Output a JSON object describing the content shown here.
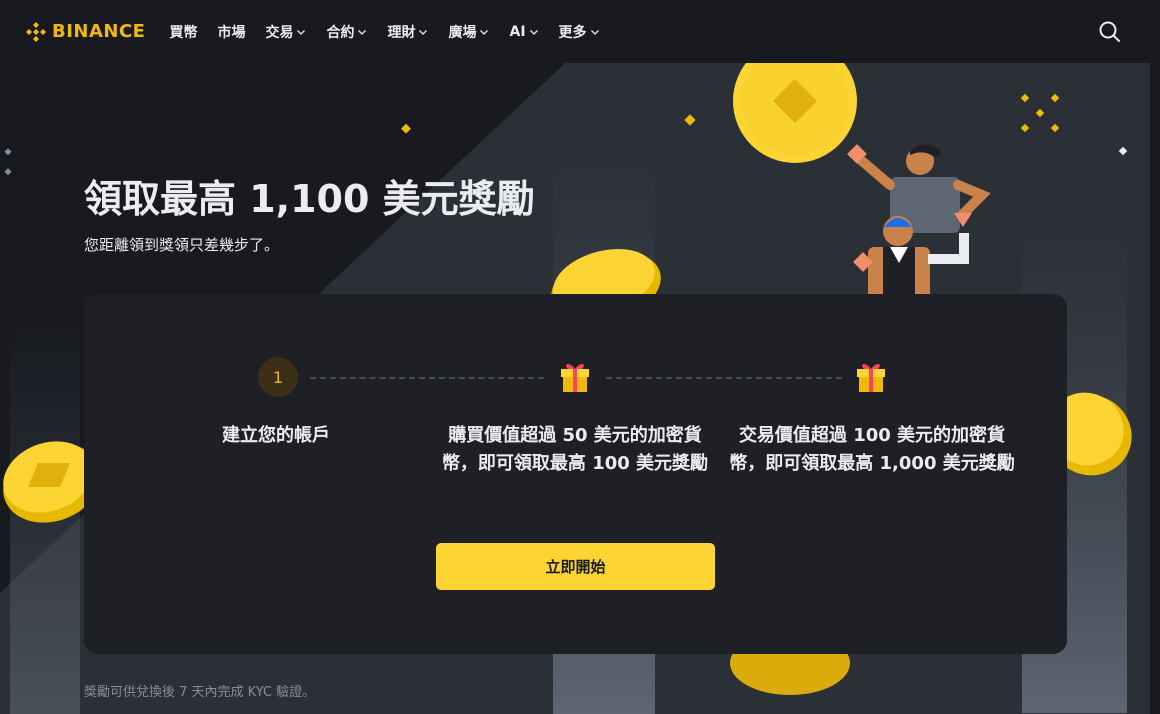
{
  "brand": {
    "name": "BINANCE",
    "colors": {
      "accent": "#f0b90b",
      "button": "#fcd535",
      "background": "#181a20",
      "card": "#1e2026"
    }
  },
  "nav": {
    "items": [
      {
        "label": "買幣",
        "has_dropdown": false
      },
      {
        "label": "市場",
        "has_dropdown": false
      },
      {
        "label": "交易",
        "has_dropdown": true
      },
      {
        "label": "合約",
        "has_dropdown": true
      },
      {
        "label": "理財",
        "has_dropdown": true
      },
      {
        "label": "廣場",
        "has_dropdown": true
      },
      {
        "label": "AI",
        "has_dropdown": true
      },
      {
        "label": "更多",
        "has_dropdown": true
      }
    ],
    "search_icon": "search-icon"
  },
  "hero": {
    "title": "領取最高 1,100 美元獎勵",
    "subtitle": "您距離領到獎領只差幾步了。"
  },
  "steps": [
    {
      "badge": "1",
      "text": "建立您的帳戶",
      "icon": "step-number"
    },
    {
      "text": "購買價值超過 50 美元的加密貨幣，即可領取最高 100 美元獎勵",
      "icon": "gift-icon"
    },
    {
      "text": "交易價值超過 100 美元的加密貨幣，即可領取最高 1,000 美元獎勵",
      "icon": "gift-icon"
    }
  ],
  "cta_label": "立即開始",
  "footnote": "獎勵可供兌換後 7 天內完成 KYC 驗證。"
}
